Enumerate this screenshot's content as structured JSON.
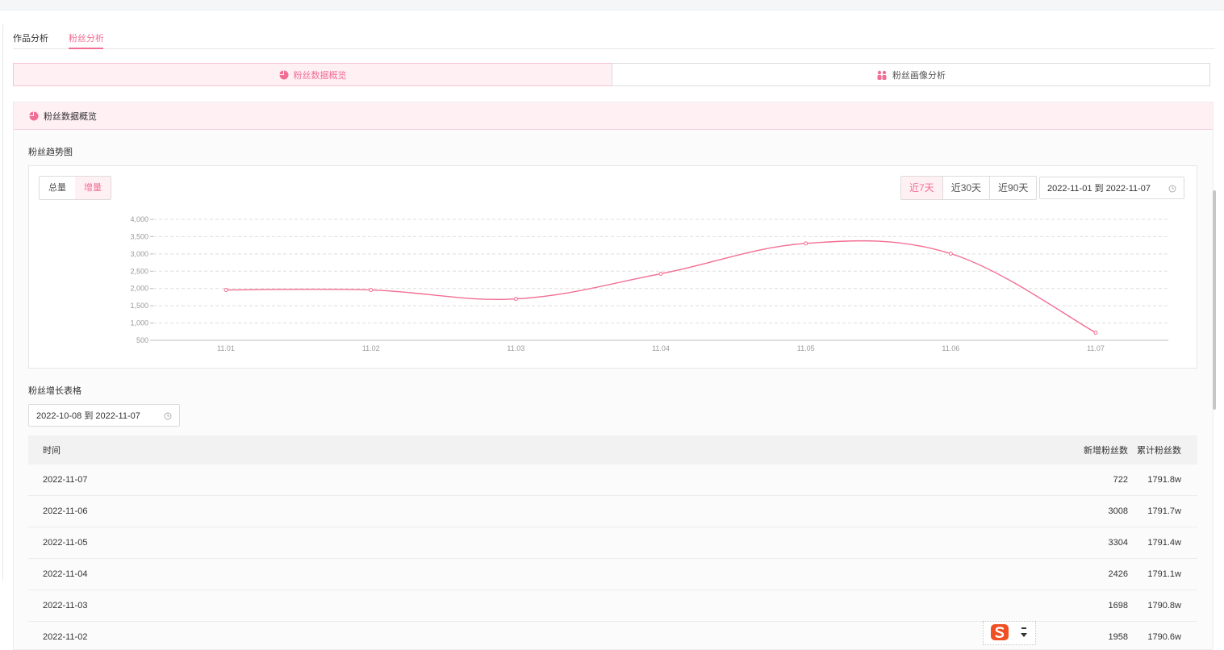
{
  "tabs": [
    {
      "label": "作品分析"
    },
    {
      "label": "粉丝分析"
    }
  ],
  "segments": {
    "overview": "粉丝数据概览",
    "portrait": "粉丝画像分析"
  },
  "panel": {
    "title": "粉丝数据概览",
    "trend_title": "粉丝趋势图",
    "toggle": {
      "total": "总量",
      "increase": "增量"
    },
    "ranges": [
      "近7天",
      "近30天",
      "近90天"
    ],
    "chart_date_range": "2022-11-01 到 2022-11-07",
    "table_title": "粉丝增长表格",
    "table_date_range": "2022-10-08 到 2022-11-07"
  },
  "colors": {
    "accent": "#f26e94",
    "accent_bg": "#fff0f4"
  },
  "chart_data": {
    "type": "line",
    "x": [
      "11.01",
      "11.02",
      "11.03",
      "11.04",
      "11.05",
      "11.06",
      "11.07"
    ],
    "yticks": [
      "500",
      "1,000",
      "1,500",
      "2,000",
      "2,500",
      "3,000",
      "3,500",
      "4,000"
    ],
    "ylim": [
      500,
      4000
    ],
    "series": [
      {
        "values": [
          1958,
          1958,
          1698,
          2426,
          3304,
          3008,
          722
        ]
      }
    ],
    "grid": true,
    "smooth": true
  },
  "table": {
    "headers": {
      "date": "时间",
      "new": "新增粉丝数",
      "total": "累计粉丝数"
    },
    "rows": [
      {
        "date": "2022-11-07",
        "new": "722",
        "total": "1791.8w"
      },
      {
        "date": "2022-11-06",
        "new": "3008",
        "total": "1791.7w"
      },
      {
        "date": "2022-11-05",
        "new": "3304",
        "total": "1791.4w"
      },
      {
        "date": "2022-11-04",
        "new": "2426",
        "total": "1791.1w"
      },
      {
        "date": "2022-11-03",
        "new": "1698",
        "total": "1790.8w"
      },
      {
        "date": "2022-11-02",
        "new": "1958",
        "total": "1790.6w"
      }
    ]
  }
}
